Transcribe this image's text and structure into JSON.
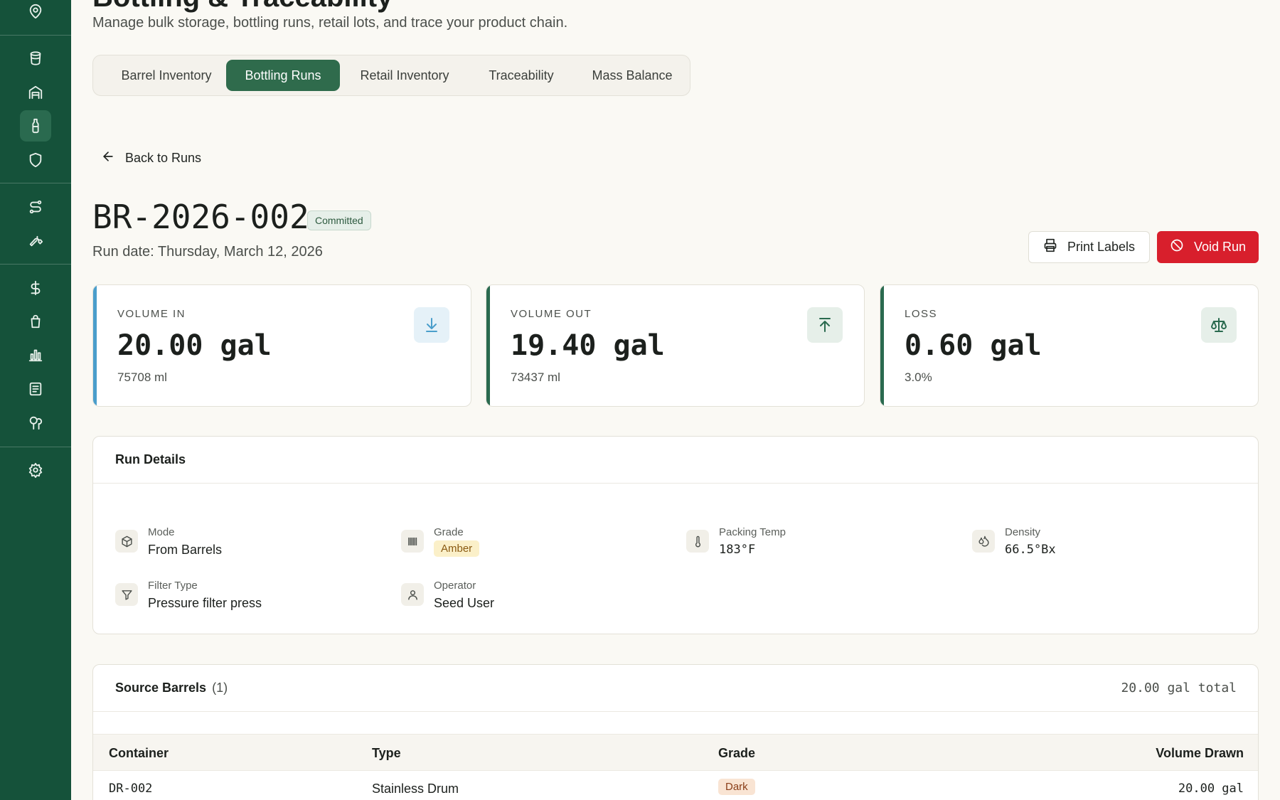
{
  "sidebar": {
    "icons": [
      "location-pin-icon",
      "barrel-icon",
      "warehouse-icon",
      "bottle-icon",
      "shield-icon",
      "route-icon",
      "wrench-icon",
      "dollar-icon",
      "shopping-bag-icon",
      "bar-chart-icon",
      "contacts-icon",
      "trees-icon",
      "settings-icon"
    ],
    "active": "bottle-icon"
  },
  "header": {
    "title": "Bottling & Traceability",
    "subtitle": "Manage bulk storage, bottling runs, retail lots, and trace your product chain."
  },
  "tabs": [
    {
      "label": "Barrel Inventory",
      "active": false
    },
    {
      "label": "Bottling Runs",
      "active": true
    },
    {
      "label": "Retail Inventory",
      "active": false
    },
    {
      "label": "Traceability",
      "active": false
    },
    {
      "label": "Mass Balance",
      "active": false
    }
  ],
  "back_label": "Back to Runs",
  "run": {
    "id": "BR-2026-002",
    "status": "Committed",
    "date": "Run date: Thursday, March 12, 2026"
  },
  "actions": {
    "print_label": "Print Labels",
    "void_label": "Void Run"
  },
  "stats": [
    {
      "label": "VOLUME IN",
      "value": "20.00 gal",
      "sub": "75708 ml",
      "icon": "download-icon",
      "color": "#4a9ecb"
    },
    {
      "label": "VOLUME OUT",
      "value": "19.40 gal",
      "sub": "73437 ml",
      "icon": "upload-icon",
      "color": "#2a6a4f"
    },
    {
      "label": "LOSS",
      "value": "0.60 gal",
      "sub": "3.0%",
      "icon": "scale-icon",
      "color": "#2a6a4f"
    }
  ],
  "details": {
    "title": "Run Details",
    "mode": {
      "label": "Mode",
      "value": "From Barrels"
    },
    "grade": {
      "label": "Grade",
      "value": "Amber"
    },
    "packing_temp": {
      "label": "Packing Temp",
      "value": "183°F"
    },
    "density": {
      "label": "Density",
      "value": "66.5°Bx"
    },
    "filter_type": {
      "label": "Filter Type",
      "value": "Pressure filter press"
    },
    "operator": {
      "label": "Operator",
      "value": "Seed User"
    }
  },
  "source_barrels": {
    "title": "Source Barrels",
    "count": "(1)",
    "total": "20.00 gal total",
    "columns": [
      "Container",
      "Type",
      "Grade",
      "Volume Drawn"
    ],
    "rows": [
      {
        "container": "DR-002",
        "type": "Stainless Drum",
        "grade": "Dark",
        "volume": "20.00 gal"
      }
    ]
  },
  "colors": {
    "brand": "#15523a",
    "danger": "#d81f2c",
    "accent_blue": "#4a9ecb"
  }
}
